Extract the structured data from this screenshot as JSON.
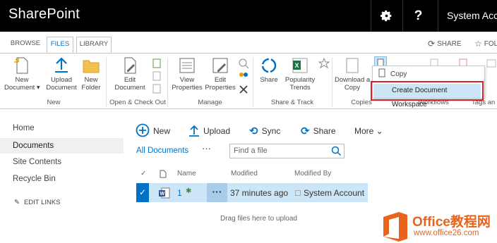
{
  "suite": {
    "brand": "SharePoint",
    "settings_icon": "gear-icon",
    "help_label": "?",
    "user": "System Acco"
  },
  "tabs": [
    {
      "label": "BROWSE"
    },
    {
      "label": "FILES"
    },
    {
      "label": "LIBRARY"
    }
  ],
  "top_actions": {
    "share": "SHARE",
    "follow": "FOL"
  },
  "ribbon": {
    "new_document": "New\nDocument ▾",
    "upload_document": "Upload\nDocument",
    "new_folder": "New\nFolder",
    "edit_document": "Edit\nDocument",
    "view_properties": "View\nProperties",
    "edit_properties": "Edit\nProperties",
    "share": "Share",
    "popularity_trends": "Popularity\nTrends",
    "download_copy": "Download a\nCopy",
    "groups": {
      "new": "New",
      "open_checkout": "Open & Check Out",
      "manage": "Manage",
      "share_track": "Share & Track",
      "copies": "Copies",
      "workflows": "Workflows",
      "tags": "Tags an"
    },
    "dropdown": {
      "copy": "Copy",
      "create_workspace": "Create Document Workspace"
    }
  },
  "leftnav": {
    "home": "Home",
    "documents": "Documents",
    "site_contents": "Site Contents",
    "recycle_bin": "Recycle Bin",
    "edit_links": "EDIT LINKS"
  },
  "toolbar": {
    "new": "New",
    "upload": "Upload",
    "sync": "Sync",
    "share": "Share",
    "more": "More ⌄"
  },
  "view": {
    "name": "All Documents",
    "ellipsis": "···",
    "search_placeholder": "Find a file"
  },
  "table": {
    "headers": {
      "check": "✓",
      "name": "Name",
      "modified": "Modified",
      "modified_by": "Modified By"
    },
    "rows": [
      {
        "name": "1",
        "new_badge": "✱",
        "ellipsis": "···",
        "modified": "37 minutes ago",
        "modified_by": "System Account"
      }
    ],
    "drag_hint": "Drag files here to upload"
  },
  "watermark": {
    "line1": "Office教程网",
    "line2": "www.office26.com"
  },
  "colors": {
    "accent": "#0072c6",
    "highlight": "#cde6f7",
    "alert": "#d2232a",
    "watermark": "#e8641c"
  }
}
